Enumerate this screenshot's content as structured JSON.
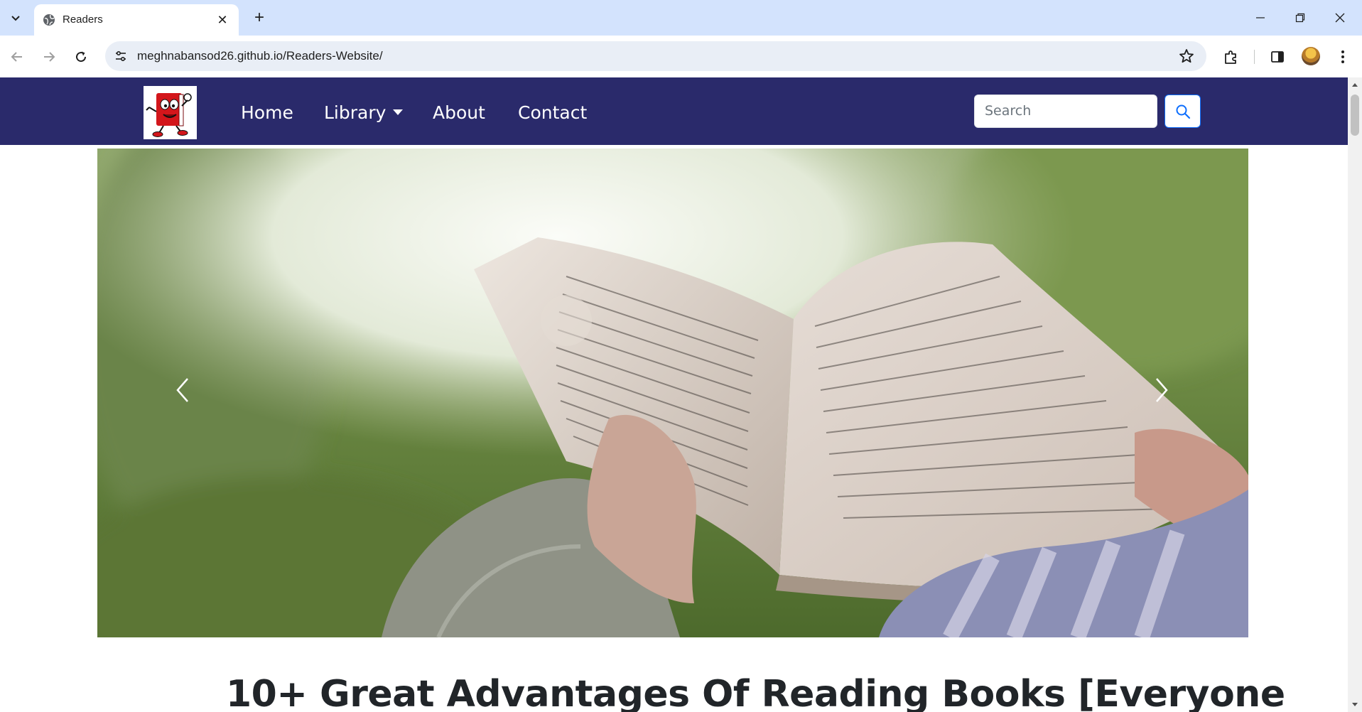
{
  "browser": {
    "tab_title": "Readers",
    "url": "meghnabansod26.github.io/Readers-Website/",
    "new_tab_symbol": "+",
    "close_symbol": "✕"
  },
  "site": {
    "nav": {
      "home": "Home",
      "library": "Library",
      "about": "About",
      "contact": "Contact"
    },
    "search": {
      "placeholder": "Search"
    },
    "colors": {
      "navbar": "#2a2a6b",
      "search_button_border": "#0d6efd"
    }
  },
  "article": {
    "title": "10+ Great Advantages Of Reading Books [Everyone"
  }
}
